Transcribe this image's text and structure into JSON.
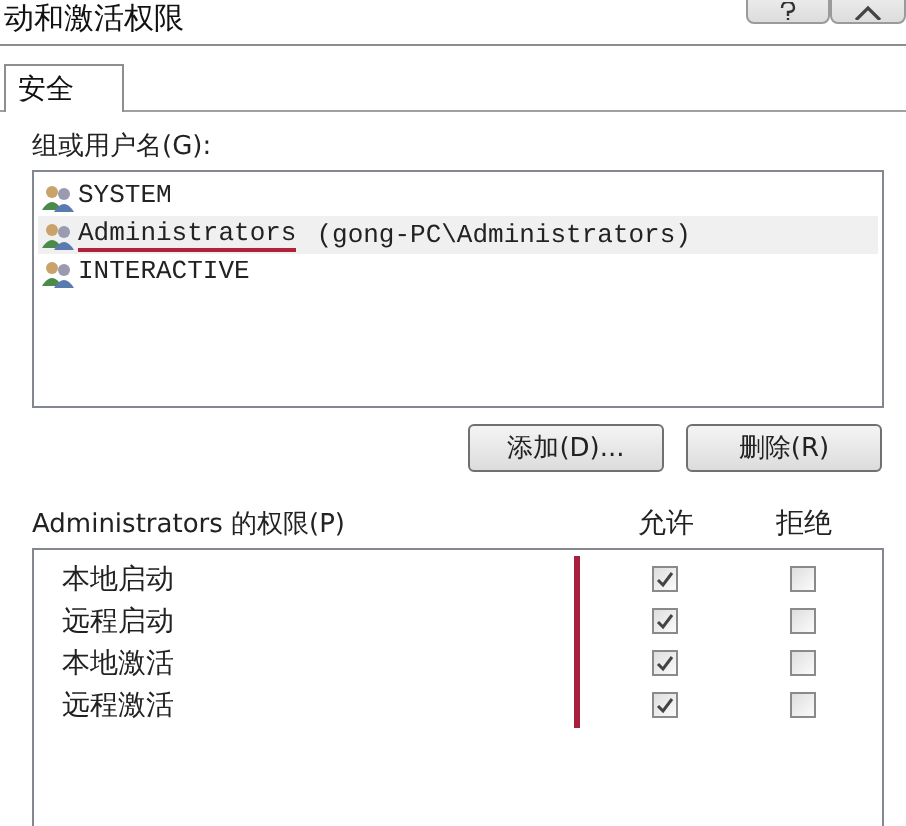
{
  "window": {
    "title": "动和激活权限"
  },
  "tabs": [
    {
      "label": "安全",
      "selected": true
    }
  ],
  "groups_label": "组或用户名(G):",
  "users": [
    {
      "name": "SYSTEM",
      "selected": false,
      "underlined": false
    },
    {
      "name": "Administrators",
      "detail": "(gong-PC\\Administrators)",
      "selected": true,
      "underlined": true
    },
    {
      "name": "INTERACTIVE",
      "selected": false,
      "underlined": false
    }
  ],
  "buttons": [
    "添加(D)...",
    "删除(R)"
  ],
  "permissions_label": "Administrators 的权限(P)",
  "columns": [
    {
      "label": "允许",
      "marked": true
    },
    {
      "label": "拒绝"
    }
  ],
  "permissions": [
    {
      "name": "本地启动",
      "allow": true,
      "deny": false
    },
    {
      "name": "远程启动",
      "allow": true,
      "deny": false
    },
    {
      "name": "本地激活",
      "allow": true,
      "deny": false
    },
    {
      "name": "远程激活",
      "allow": true,
      "deny": false
    }
  ]
}
